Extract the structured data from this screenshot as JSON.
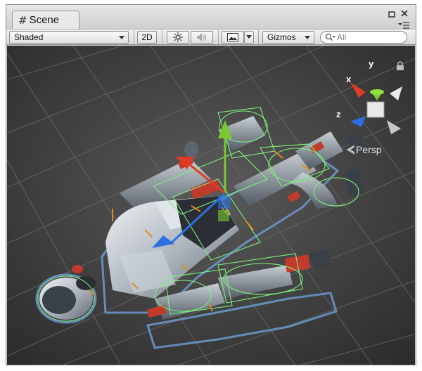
{
  "window": {
    "tab_label": "Scene",
    "tab_icon": "#"
  },
  "window_controls": {
    "maximize_icon": "maximize-icon",
    "close_icon": "close-icon",
    "menu_icon": "menu-icon"
  },
  "toolbar": {
    "shading_mode": "Shaded",
    "mode_2d_label": "2D",
    "lighting_icon": "sun-icon",
    "audio_icon": "speaker-icon",
    "effects_icon": "image-icon",
    "gizmos_label": "Gizmos",
    "search_placeholder": "All"
  },
  "scene": {
    "projection_label": "Persp",
    "axis_labels": {
      "x": "x",
      "y": "y",
      "z": "z"
    },
    "colors": {
      "background": "#505050",
      "x_axis": "#e03a22",
      "y_axis": "#7ac92e",
      "z_axis": "#2c6fe0",
      "collider_wire": "#7cf27c",
      "selection_outline": "#6fa0d8"
    }
  }
}
